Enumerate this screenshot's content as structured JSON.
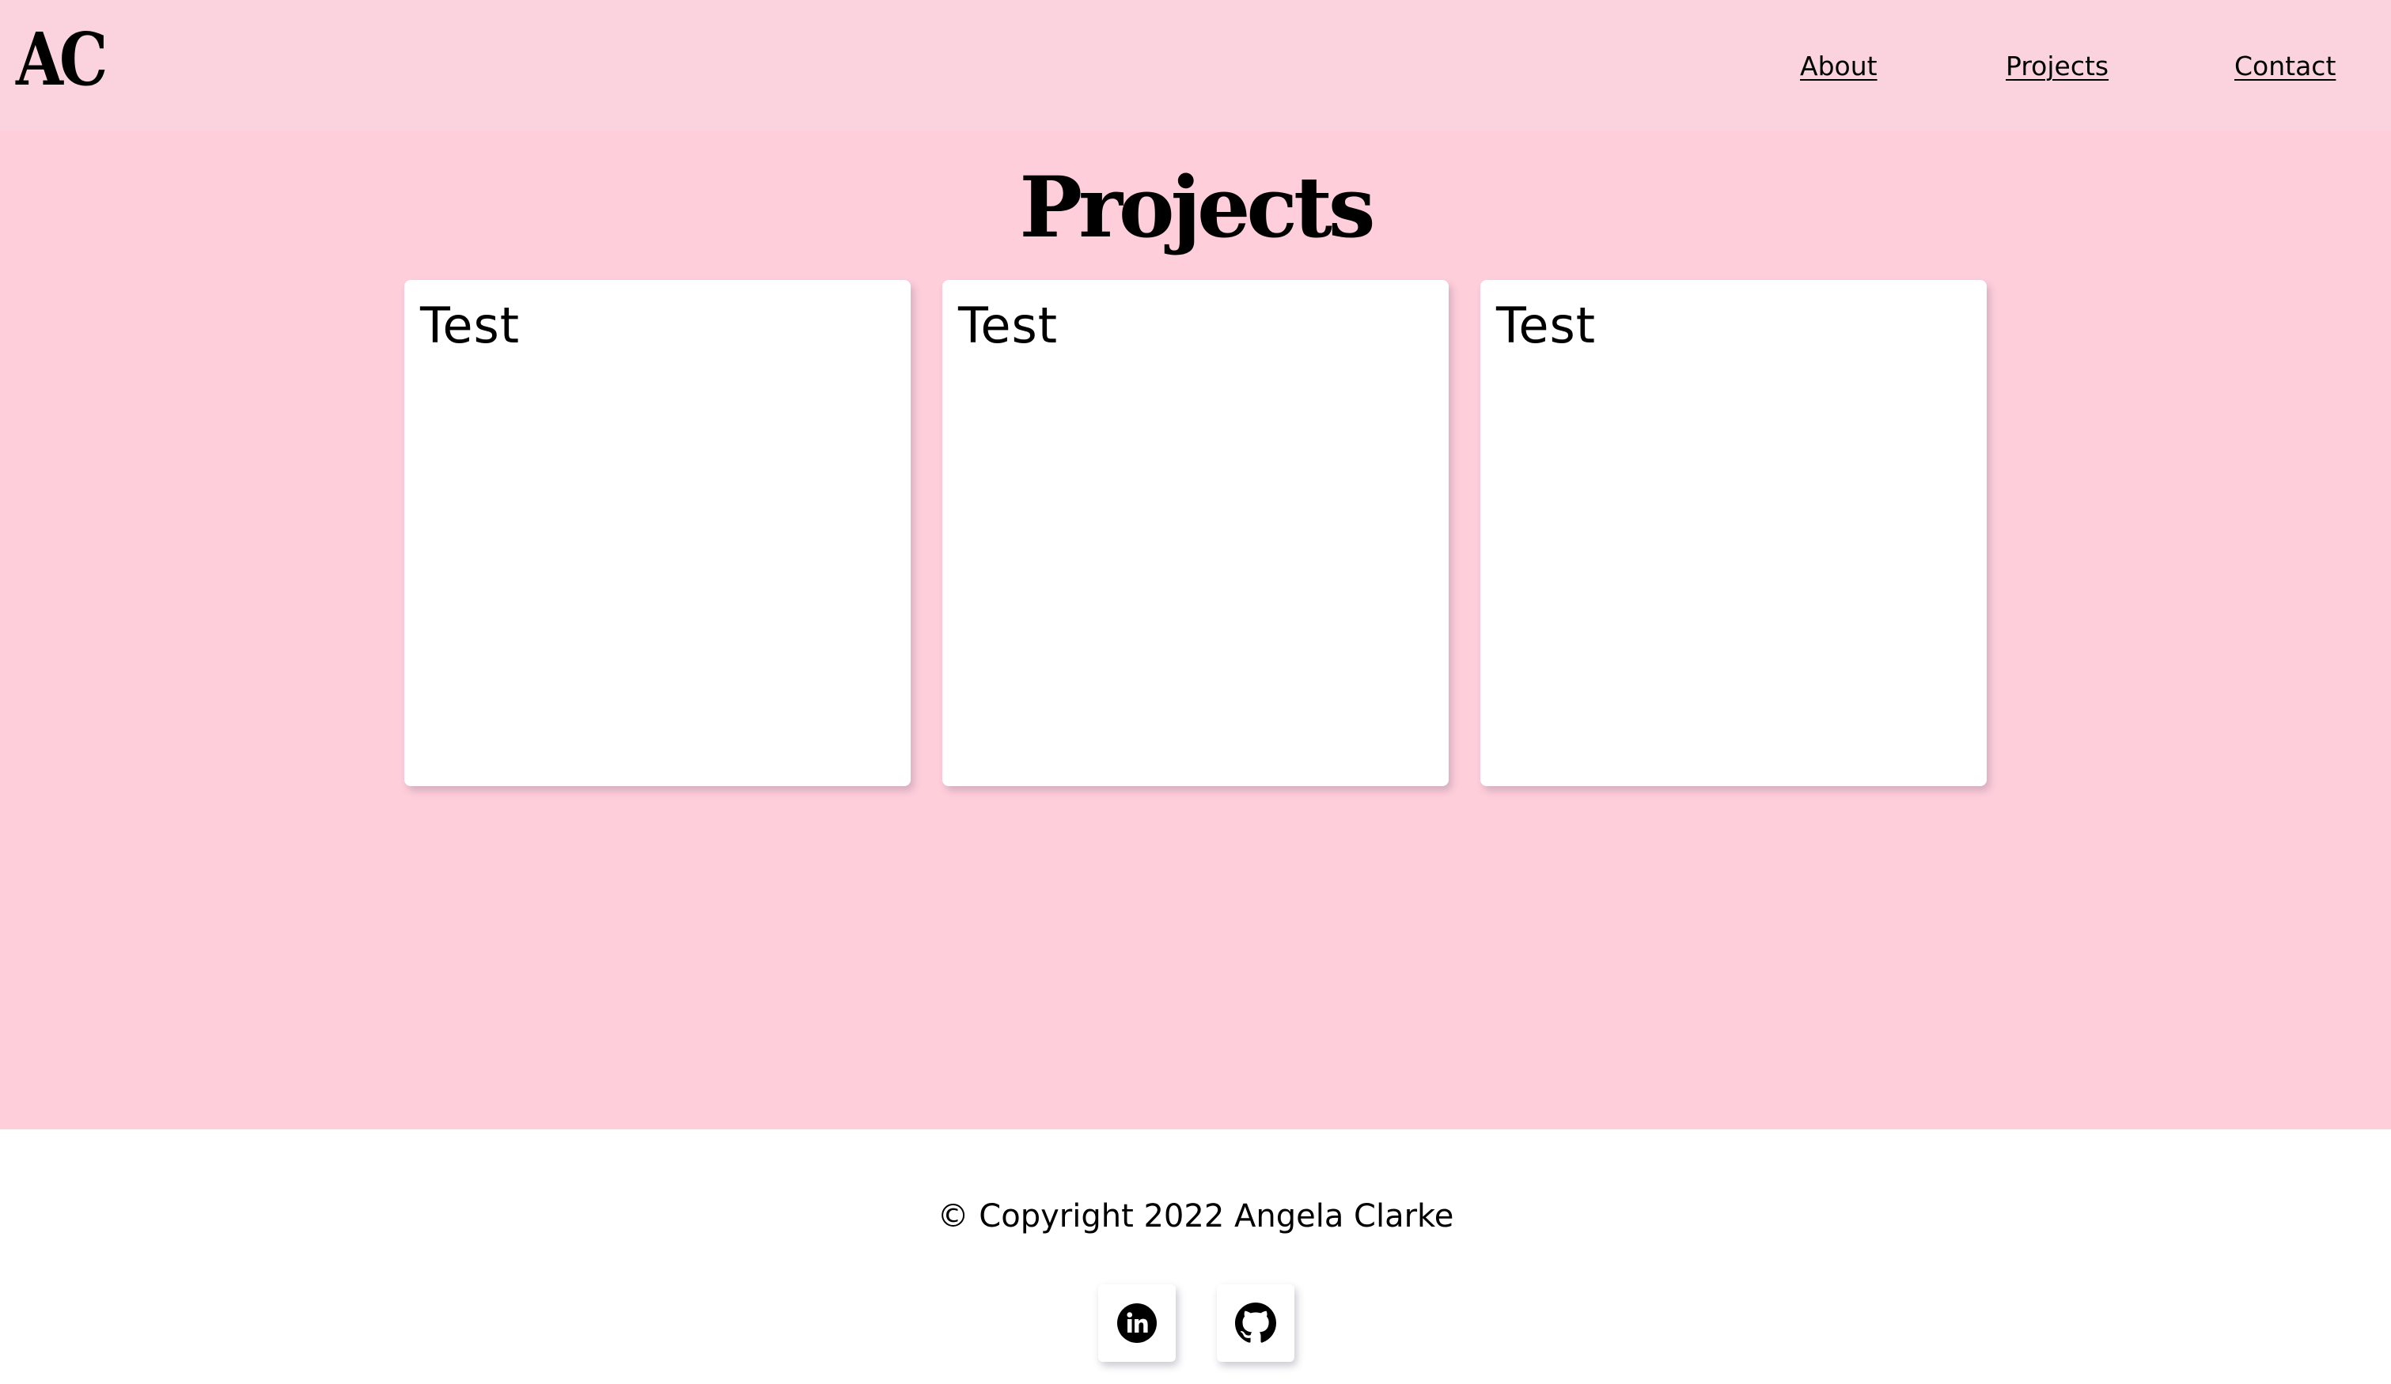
{
  "navbar": {
    "logo": "AC",
    "links": [
      {
        "label": "About"
      },
      {
        "label": "Projects"
      },
      {
        "label": "Contact"
      }
    ],
    "background": "#fad3df"
  },
  "main": {
    "title": "Projects",
    "background": "#ffcedb",
    "cards": [
      {
        "title": "Test"
      },
      {
        "title": "Test"
      },
      {
        "title": "Test"
      }
    ]
  },
  "footer": {
    "copyright": "© Copyright 2022 Angela Clarke",
    "background": "#ffffff",
    "social": [
      {
        "icon": "linkedin-icon"
      },
      {
        "icon": "github-icon"
      }
    ]
  }
}
